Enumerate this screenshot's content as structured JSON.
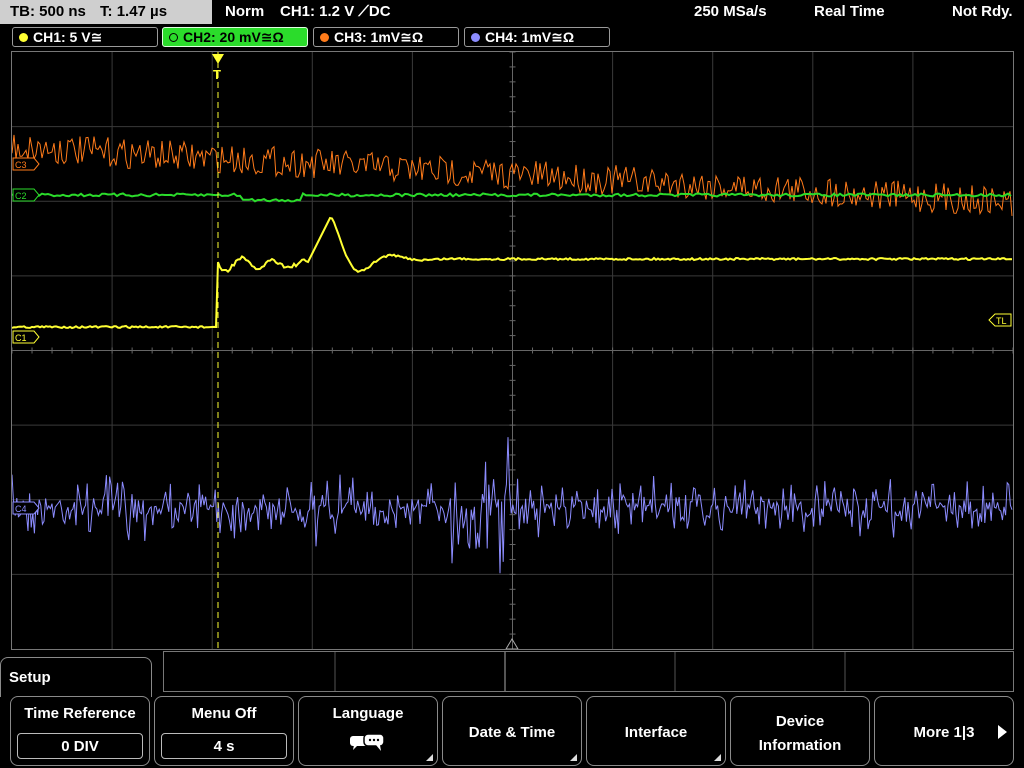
{
  "status": {
    "timebase": "TB: 500 ns",
    "trigger_time": "T: 1.47 µs",
    "mode": "Norm",
    "trigger_info": "CH1: 1.2 V ⟋DC",
    "sample_rate": "250 MSa/s",
    "acq_mode": "Real Time",
    "state": "Not Rdy."
  },
  "channels": [
    {
      "label": "CH1: 5 V≅",
      "color": "#ffff33",
      "marker": "C1"
    },
    {
      "label": "CH2: 20 mV≅Ω",
      "color": "#2bdc2b",
      "marker": "C2"
    },
    {
      "label": "CH3: 1mV≅Ω",
      "color": "#ff7b1a",
      "marker": "C3"
    },
    {
      "label": "CH4: 1mV≅Ω",
      "color": "#8c8cff",
      "marker": "C4"
    }
  ],
  "markers": {
    "trigger_level": "TL",
    "trigger_position": "T"
  },
  "menu": {
    "title": "Setup",
    "softkeys": [
      {
        "label": "Time Reference",
        "value": "0 DIV"
      },
      {
        "label": "Menu Off",
        "value": "4 s"
      },
      {
        "label": "Language",
        "icon": "speech-bubbles-icon"
      },
      {
        "label": "Date & Time"
      },
      {
        "label": "Interface"
      },
      {
        "label_line1": "Device",
        "label_line2": "Information"
      },
      {
        "label": "More 1|3"
      }
    ]
  }
}
